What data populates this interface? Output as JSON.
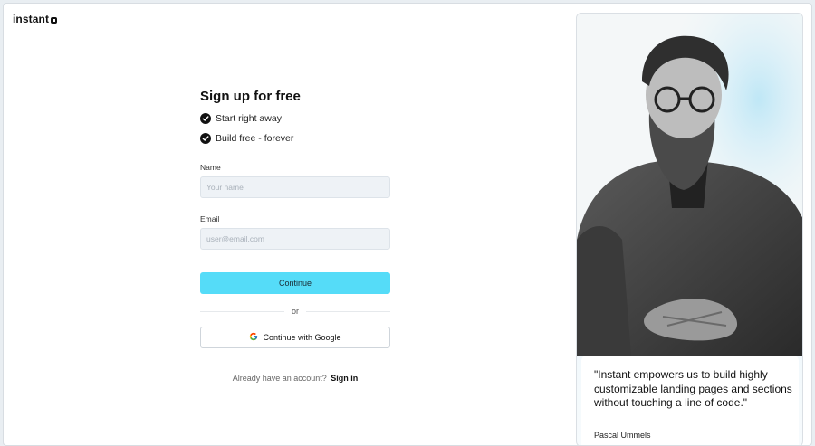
{
  "brand": {
    "logo_text": "instant"
  },
  "signup": {
    "title": "Sign up for free",
    "features": [
      "Start right away",
      "Build free - forever"
    ],
    "name_label": "Name",
    "name_placeholder": "Your name",
    "email_label": "Email",
    "email_placeholder": "user@email.com",
    "continue_label": "Continue",
    "divider_text": "or",
    "google_label": "Continue with Google",
    "account_prompt": "Already have an account?",
    "signin_label": "Sign in"
  },
  "testimonial": {
    "quote": "\"Instant empowers us to build highly customizable landing pages and sections without touching a line of code.\"",
    "author": "Pascal Ummels"
  },
  "colors": {
    "primary": "#55dcf8",
    "text": "#111111",
    "input_bg": "#eef2f6"
  },
  "icons": [
    "check-circle-icon",
    "google-icon",
    "logo-mark-icon"
  ]
}
